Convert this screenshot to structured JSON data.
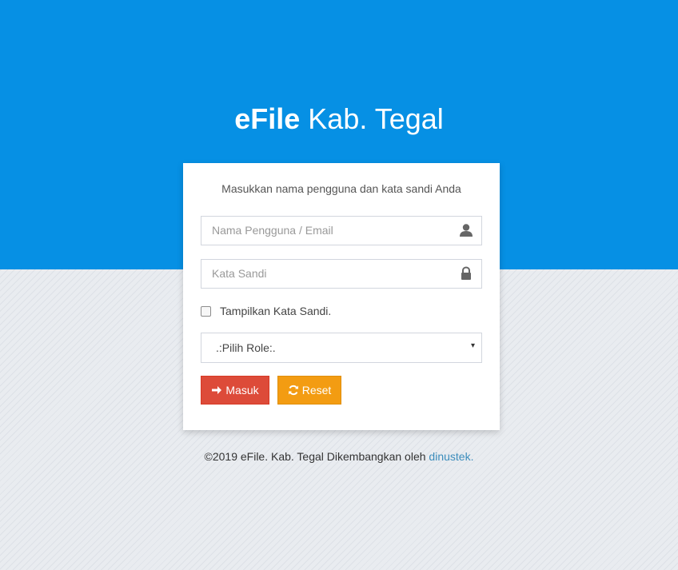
{
  "brand": {
    "bold": "eFile",
    "light": "Kab. Tegal"
  },
  "login": {
    "heading": "Masukkan nama pengguna dan kata sandi Anda",
    "username": {
      "placeholder": "Nama Pengguna / Email",
      "value": "",
      "icon": "user-icon"
    },
    "password": {
      "placeholder": "Kata Sandi",
      "value": "",
      "icon": "lock-icon"
    },
    "show_password": {
      "label": "Tampilkan Kata Sandi.",
      "checked": false
    },
    "role_select": {
      "selected": ".:Pilih Role:.",
      "arrow": "▾"
    },
    "buttons": {
      "submit": "Masuk",
      "reset": "Reset"
    }
  },
  "footer": {
    "text": "©2019 eFile. Kab. Tegal Dikembangkan oleh",
    "link": "dinustek."
  },
  "colors": {
    "header_bg": "#0690e4",
    "submit_btn": "#dd4b39",
    "reset_btn": "#f39c12",
    "link": "#3c8dbc"
  }
}
